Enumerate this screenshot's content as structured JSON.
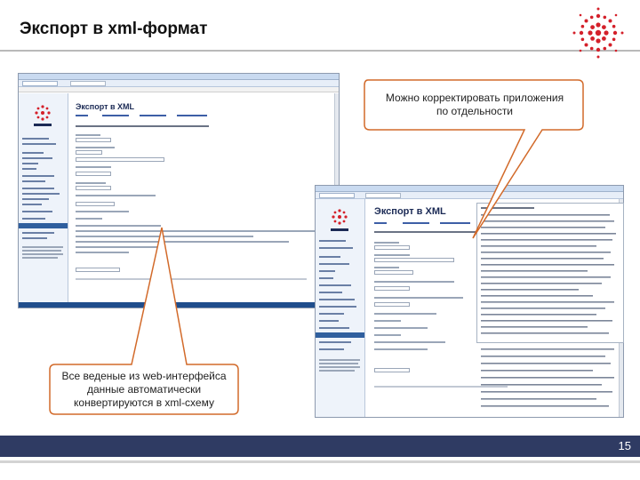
{
  "slide": {
    "title": "Экспорт в xml-формат",
    "page_number": "15"
  },
  "callouts": {
    "top": "Можно корректировать приложения по отдельности",
    "bottom": "Все веденые из web-интерфейса данные автоматически конвертируются в xml-схему"
  },
  "screenshot_left": {
    "heading": "Экспорт в XML"
  },
  "screenshot_right": {
    "heading": "Экспорт в XML"
  },
  "colors": {
    "accent_red": "#d4202a",
    "callout_fill": "#ffffff",
    "callout_stroke": "#d26a2a",
    "footer": "#2f3b63"
  }
}
